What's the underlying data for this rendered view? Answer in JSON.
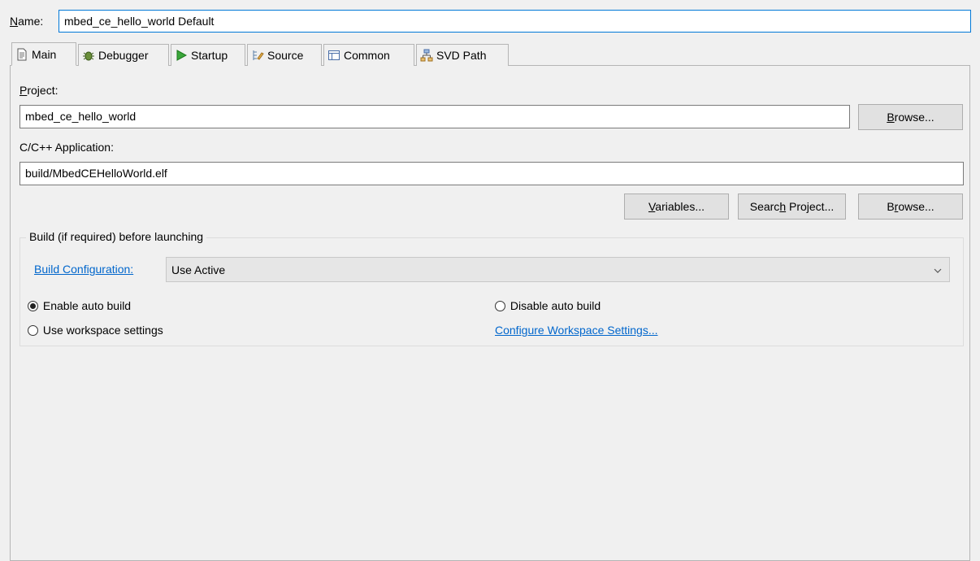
{
  "name_field": {
    "label": "Name:",
    "value": "mbed_ce_hello_world Default"
  },
  "tabs": [
    {
      "label": "Main",
      "icon": "document-icon"
    },
    {
      "label": "Debugger",
      "icon": "bug-icon"
    },
    {
      "label": "Startup",
      "icon": "play-icon"
    },
    {
      "label": "Source",
      "icon": "source-icon"
    },
    {
      "label": "Common",
      "icon": "table-icon"
    },
    {
      "label": "SVD Path",
      "icon": "tree-icon"
    }
  ],
  "project": {
    "label": "Project:",
    "value": "mbed_ce_hello_world",
    "browse_label": "Browse..."
  },
  "application": {
    "label": "C/C++ Application:",
    "value": "build/MbedCEHelloWorld.elf",
    "variables_label": "Variables...",
    "search_label": "Search Project...",
    "browse_label": "Browse..."
  },
  "build": {
    "group_title": "Build (if required) before launching",
    "config_link": "Build Configuration:",
    "config_value": "Use Active",
    "enable_auto": "Enable auto build",
    "disable_auto": "Disable auto build",
    "use_workspace": "Use workspace settings",
    "configure_link": "Configure Workspace Settings...",
    "selected": "enable_auto"
  },
  "colors": {
    "link": "#0066cc",
    "panel": "#f0f0f0",
    "focus_border": "#0078d7"
  }
}
